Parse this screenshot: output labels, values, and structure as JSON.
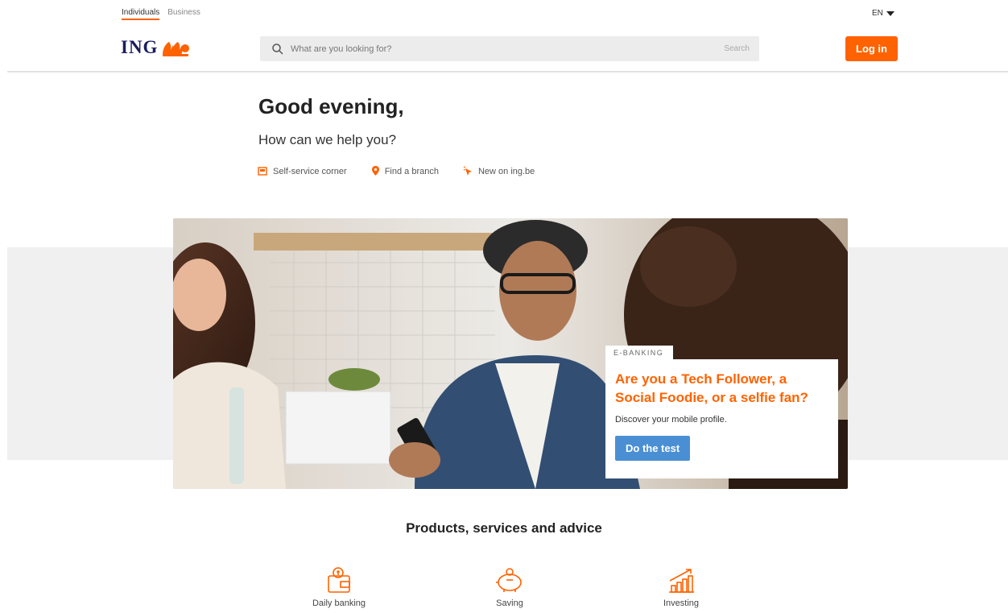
{
  "audience": {
    "tabs": [
      "Individuals",
      "Business"
    ]
  },
  "language": {
    "current": "EN"
  },
  "brand": {
    "logo_text": "ING",
    "accent": "#ff6200",
    "navy": "#1b1f5f"
  },
  "search": {
    "placeholder": "What are you looking for?",
    "button": "Search"
  },
  "header": {
    "login_label": "Log in"
  },
  "greeting": {
    "title": "Good evening,",
    "subtitle": "How can we help you?"
  },
  "quicklinks": [
    {
      "label": "Self-service corner",
      "icon": "self-service-icon"
    },
    {
      "label": "Find a branch",
      "icon": "map-pin-icon"
    },
    {
      "label": "New on ing.be",
      "icon": "new-cursor-icon"
    }
  ],
  "hero": {
    "tag": "E-BANKING",
    "title": "Are you a Tech Follower, a Social Foodie, or a selfie fan?",
    "text": "Discover your mobile profile.",
    "button": "Do the test",
    "button_color": "#4a8fd4"
  },
  "products": {
    "title": "Products, services and advice",
    "items": [
      {
        "label": "Daily banking",
        "icon": "wallet-icon"
      },
      {
        "label": "Saving",
        "icon": "piggy-bank-icon"
      },
      {
        "label": "Investing",
        "icon": "growth-chart-icon"
      }
    ]
  }
}
